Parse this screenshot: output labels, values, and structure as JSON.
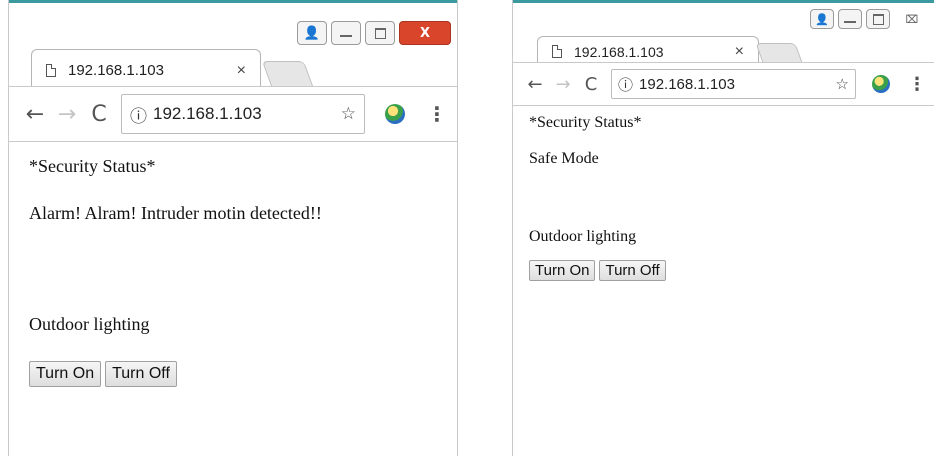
{
  "windows": [
    {
      "tab": {
        "title": "192.168.1.103",
        "close": "×"
      },
      "window_controls": {
        "user": "👤",
        "close": "X"
      },
      "toolbar": {
        "back": "←",
        "forward": "→",
        "reload": "C",
        "info": "ⓘ",
        "url": "192.168.1.103",
        "star": "☆",
        "menu": "⋮"
      },
      "content": {
        "heading": "*Security Status*",
        "status": "Alarm! Alram! Intruder motin detected!!",
        "section": "Outdoor lighting",
        "turn_on": "Turn On",
        "turn_off": "Turn Off"
      }
    },
    {
      "tab": {
        "title": "192.168.1.103",
        "close": "×"
      },
      "window_controls": {
        "user": "👤",
        "close": "⌧"
      },
      "toolbar": {
        "back": "←",
        "forward": "→",
        "reload": "C",
        "info": "ⓘ",
        "url": "192.168.1.103",
        "star": "☆",
        "menu": "⋮"
      },
      "content": {
        "heading": "*Security Status*",
        "status": "Safe Mode",
        "section": "Outdoor lighting",
        "turn_on": "Turn On",
        "turn_off": "Turn Off"
      }
    }
  ],
  "colors": {
    "title_accent": "#3a9aa0",
    "close_red": "#d9452a"
  }
}
